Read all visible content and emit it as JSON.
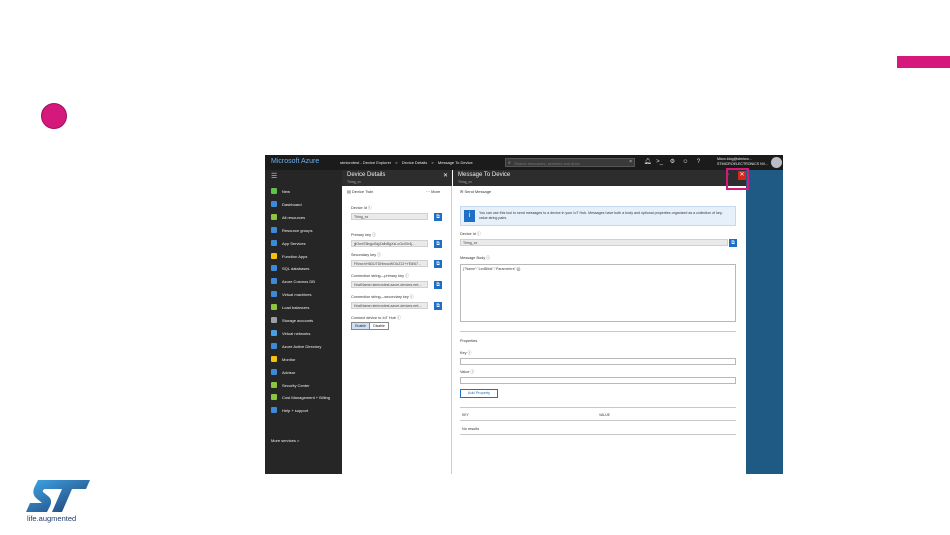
{
  "topbar": {
    "brand": "Microsoft Azure",
    "breadcrumbs": [
      "stmicrotest - Device Explorer",
      ">",
      "Device Details",
      ">",
      "Message To Device"
    ],
    "search_placeholder": "Search resources, services and docs",
    "user_line1": "Micro.blog@stmicro...",
    "user_line2": "STMICROELECTRONICS NV..."
  },
  "sidebar": {
    "items": [
      {
        "label": "New",
        "color": "#5ec14a"
      },
      {
        "label": "Dashboard",
        "color": "#3b8ad8"
      },
      {
        "label": "All resources",
        "color": "#8cc63f"
      },
      {
        "label": "Resource groups",
        "color": "#3b8ad8"
      },
      {
        "label": "App Services",
        "color": "#3b8ad8"
      },
      {
        "label": "Function Apps",
        "color": "#f4c20d"
      },
      {
        "label": "SQL databases",
        "color": "#3b8ad8"
      },
      {
        "label": "Azure Cosmos DB",
        "color": "#3b8ad8"
      },
      {
        "label": "Virtual machines",
        "color": "#3b8ad8"
      },
      {
        "label": "Load balancers",
        "color": "#8cc63f"
      },
      {
        "label": "Storage accounts",
        "color": "#9aa0a6"
      },
      {
        "label": "Virtual networks",
        "color": "#48a0e0"
      },
      {
        "label": "Azure Active Directory",
        "color": "#3b8ad8"
      },
      {
        "label": "Monitor",
        "color": "#f4c20d"
      },
      {
        "label": "Advisor",
        "color": "#3b8ad8"
      },
      {
        "label": "Security Center",
        "color": "#8cc63f"
      },
      {
        "label": "Cost Management + Billing",
        "color": "#8cc63f"
      },
      {
        "label": "Help + support",
        "color": "#3b8ad8"
      }
    ],
    "more": "More services >"
  },
  "device_details": {
    "title": "Device Details",
    "subtitle": "Thing_xx",
    "cmd_twin": "Device Twin",
    "cmd_more": "··· More",
    "device_id_label": "Device Id",
    "device_id": "Thing_xx",
    "primary_key_label": "Primary key",
    "primary_key": "jjlOrmS3bqjuINgZaflvBgXzLoGzX0r4j...",
    "secondary_key_label": "Secondary key",
    "secondary_key": "FKbcr/vH6DUTDI9mocWOUZ12+YE8/67...",
    "conn_primary_label": "Connection string—primary key",
    "conn_primary": "HostName=stmicrotest.azure-devices.net;...",
    "conn_secondary_label": "Connection string—secondary key",
    "conn_secondary": "HostName=stmicrotest.azure-devices.net;...",
    "connect_label": "Connect device to IoT Hub",
    "enable": "Enable",
    "disable": "Disable"
  },
  "message_to_device": {
    "title": "Message To Device",
    "subtitle": "Thing_xx",
    "send_message": "Send Message",
    "info_text": "You can use this tool to send messages to a device in your IoT Hub. Messages have both a body and optional properties organized as a collection of key-value string pairs.",
    "device_id_label": "Device Id",
    "device_id": "Thing_xx",
    "message_body_label": "Message Body",
    "message_body": "{\"Name\":\"LedBlink\",\"Parameters\":{}}",
    "properties_label": "Properties",
    "key_label": "Key",
    "value_label": "Value",
    "add_property": "Add Property",
    "col_key": "KEY",
    "col_value": "VALUE",
    "no_results": "No results"
  },
  "st_logo": {
    "tagline": "life.augmented",
    "color": "#1f3a70"
  },
  "colors": {
    "accent_pink": "#d4187c",
    "azure_blue": "#1f6fc4",
    "close_red": "#d9261c"
  }
}
